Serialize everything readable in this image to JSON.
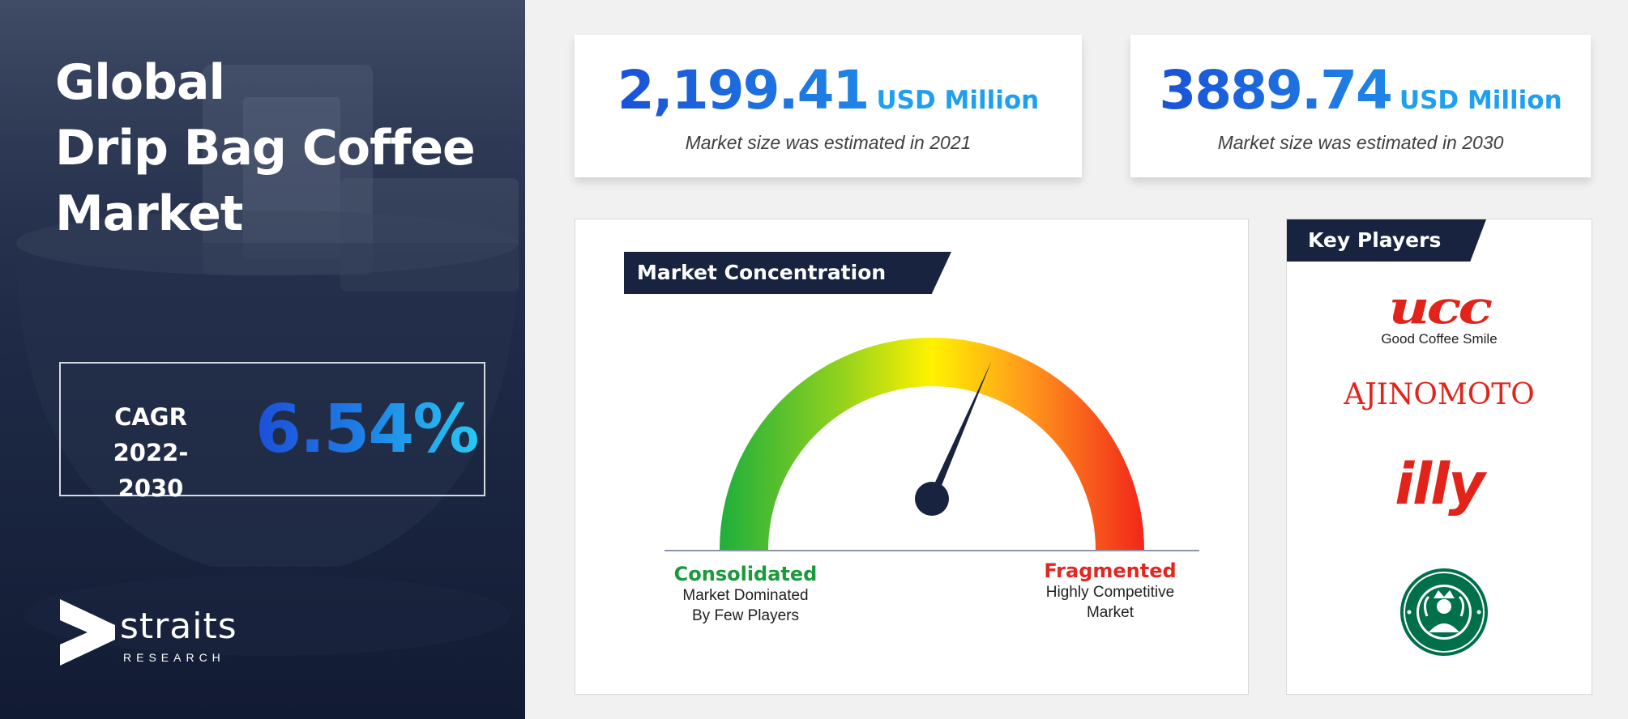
{
  "title": {
    "line1": "Global",
    "line2": "Drip Bag Coffee",
    "line3": "Market"
  },
  "cagr": {
    "label_line1": "CAGR",
    "label_line2": "2022-2030",
    "value": "6.54%"
  },
  "brand": {
    "name": "straits",
    "sub": "RESEARCH"
  },
  "stats": [
    {
      "value": "2,199.41",
      "unit": "USD Million",
      "caption": "Market size was estimated  in 2021"
    },
    {
      "value": "3889.74",
      "unit": "USD Million",
      "caption": "Market size was estimated  in 2030"
    }
  ],
  "concentration": {
    "heading": "Market Concentration",
    "left_title": "Consolidated",
    "left_line1": "Market Dominated",
    "left_line2": "By Few Players",
    "right_title": "Fragmented",
    "right_line1": "Highly Competitive",
    "right_line2": "Market",
    "needle_level": 0.63
  },
  "key_players": {
    "heading": "Key Players",
    "players": [
      {
        "name": "UCC",
        "tagline": "Good Coffee Smile"
      },
      {
        "name": "AJINOMOTO"
      },
      {
        "name": "illy"
      },
      {
        "name": "Starbucks Coffee"
      }
    ]
  },
  "colors": {
    "navy": "#17233f",
    "accent_blue": "#1e9ff0",
    "green": "#1a9a3a",
    "red": "#e3261f",
    "brand_red": "#e2231a"
  }
}
